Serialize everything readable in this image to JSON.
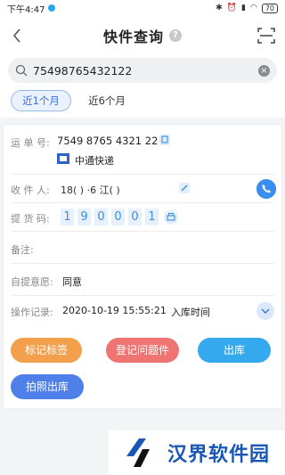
{
  "status_bar": {
    "time": "下午4:47",
    "battery": "70"
  },
  "header": {
    "title": "快件查询",
    "help_label": "?"
  },
  "search": {
    "query": "75498765432122"
  },
  "tabs": [
    {
      "label": "近1个月",
      "active": true
    },
    {
      "label": "近6个月",
      "active": false
    }
  ],
  "detail": {
    "waybill_label": "运 单 号:",
    "waybill_number": "7549  8765  4321  22",
    "carrier": "中通快递",
    "recipient_label": "收 件 人:",
    "recipient_value": "18(    )  ·6  江(   )",
    "pickup_label": "提 货 码:",
    "pickup_digits": [
      "1",
      "9",
      "0",
      "0",
      "0",
      "1"
    ],
    "remark_label": "备注:",
    "self_pickup_label": "自提意愿:",
    "self_pickup_value": "同意",
    "log_label": "操作记录:",
    "log_time": "2020-10-19 15:55:21",
    "log_action": "入库时间"
  },
  "buttons": {
    "mark_label": "标记标签",
    "register_issue": "登记问题件",
    "checkout": "出库",
    "photo_checkout": "拍照出库"
  },
  "watermark": {
    "text": "汉界软件园"
  },
  "colors": {
    "primary_blue": "#3a8ef0",
    "orange": "#f3a04c",
    "red": "#ef7472",
    "sky": "#35a9ee",
    "indigo": "#4f7fe8"
  }
}
